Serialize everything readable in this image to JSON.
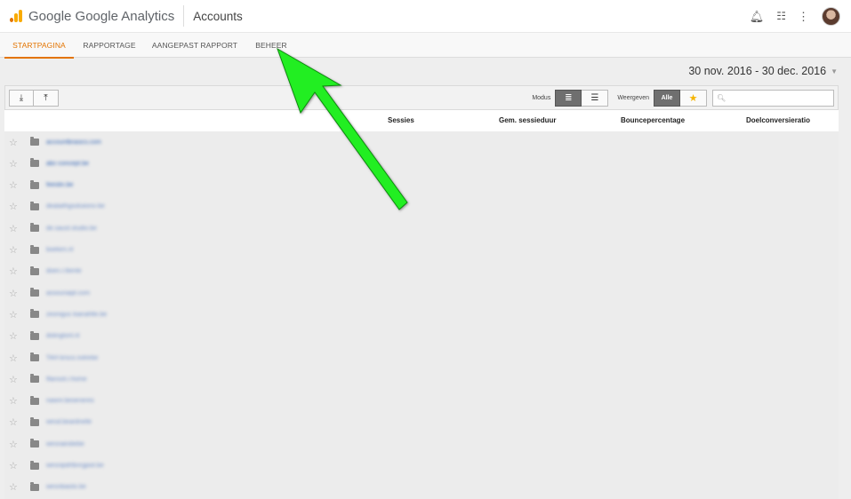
{
  "header": {
    "brand": "Google Google Analytics",
    "title": "Accounts",
    "icons": [
      "bell-icon",
      "apps-grid-icon",
      "more-vert-icon",
      "avatar"
    ]
  },
  "nav": {
    "tabs": [
      {
        "label": "STARTPAGINA",
        "active": true
      },
      {
        "label": "RAPPORTAGE",
        "active": false
      },
      {
        "label": "AANGEPAST RAPPORT",
        "active": false
      },
      {
        "label": "BEHEER",
        "active": false
      }
    ]
  },
  "date_range": "30 nov. 2016 - 30 dec. 2016",
  "toolbar": {
    "modus_label": "Modus",
    "weergeven_label": "Weergeven",
    "alle_label": "Alle",
    "search_placeholder": ""
  },
  "table": {
    "columns": [
      "Sessies",
      "Gem. sessieduur",
      "Bouncepercentage",
      "Doelconversieratio"
    ]
  },
  "accounts": [
    "accountbrasics.com",
    "abc-concept.be",
    "feestin.be",
    "dealaithgsoluiions-be",
    "de.saust.studio.be",
    "boeken.nl",
    "doen.r.lliente",
    "assouriaipt.com",
    "zeonigus loanahlte.be",
    "dolingtonl.nl",
    "TAH brsco.notrebe",
    "fllansot.r.home",
    "nawnr.beoeneres",
    "wesd.beardnelle",
    "wesnaindiebe",
    "wesnipdrtbnrgpiol.be",
    "wesnbiasto.be"
  ],
  "colors": {
    "accent": "#e37400",
    "arrow": "#22ee22",
    "link": "#2b5fb3"
  }
}
